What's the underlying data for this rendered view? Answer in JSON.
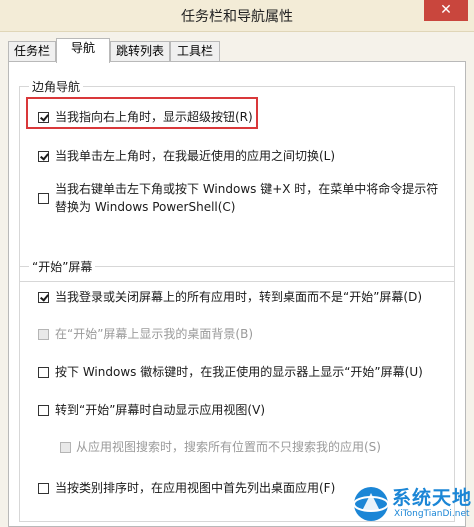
{
  "window": {
    "title": "任务栏和导航属性",
    "close_glyph": "✕"
  },
  "tabs": [
    {
      "label": "任务栏",
      "active": false
    },
    {
      "label": "导航",
      "active": true
    },
    {
      "label": "跳转列表",
      "active": false
    },
    {
      "label": "工具栏",
      "active": false
    }
  ],
  "corner_nav": {
    "legend": "边角导航",
    "options": [
      {
        "label": "当我指向右上角时，显示超级按钮(R)",
        "checked": true,
        "enabled": true
      },
      {
        "label": "当我单击左上角时，在我最近使用的应用之间切换(L)",
        "checked": true,
        "enabled": true
      },
      {
        "label": "当我右键单击左下角或按下 Windows 键+X 时，在菜单中将命令提示符",
        "label2": "替换为 Windows PowerShell(C)",
        "checked": false,
        "enabled": true
      }
    ]
  },
  "start_screen": {
    "legend": "“开始”屏幕",
    "options": [
      {
        "label": "当我登录或关闭屏幕上的所有应用时，转到桌面而不是“开始”屏幕(D)",
        "checked": true,
        "enabled": true
      },
      {
        "label": "在“开始”屏幕上显示我的桌面背景(B)",
        "checked": false,
        "enabled": false
      },
      {
        "label": "按下 Windows 徽标键时，在我正使用的显示器上显示“开始”屏幕(U)",
        "checked": false,
        "enabled": true
      },
      {
        "label": "转到“开始”屏幕时自动显示应用视图(V)",
        "checked": false,
        "enabled": true
      },
      {
        "label": "从应用视图搜索时，搜索所有位置而不只搜索我的应用(S)",
        "checked": false,
        "enabled": false
      },
      {
        "label": "当按类别排序时，在应用视图中首先列出桌面应用(F)",
        "checked": false,
        "enabled": true
      }
    ]
  },
  "watermark": {
    "brand": "系统天地",
    "url": "XiTongTianDi.net"
  }
}
